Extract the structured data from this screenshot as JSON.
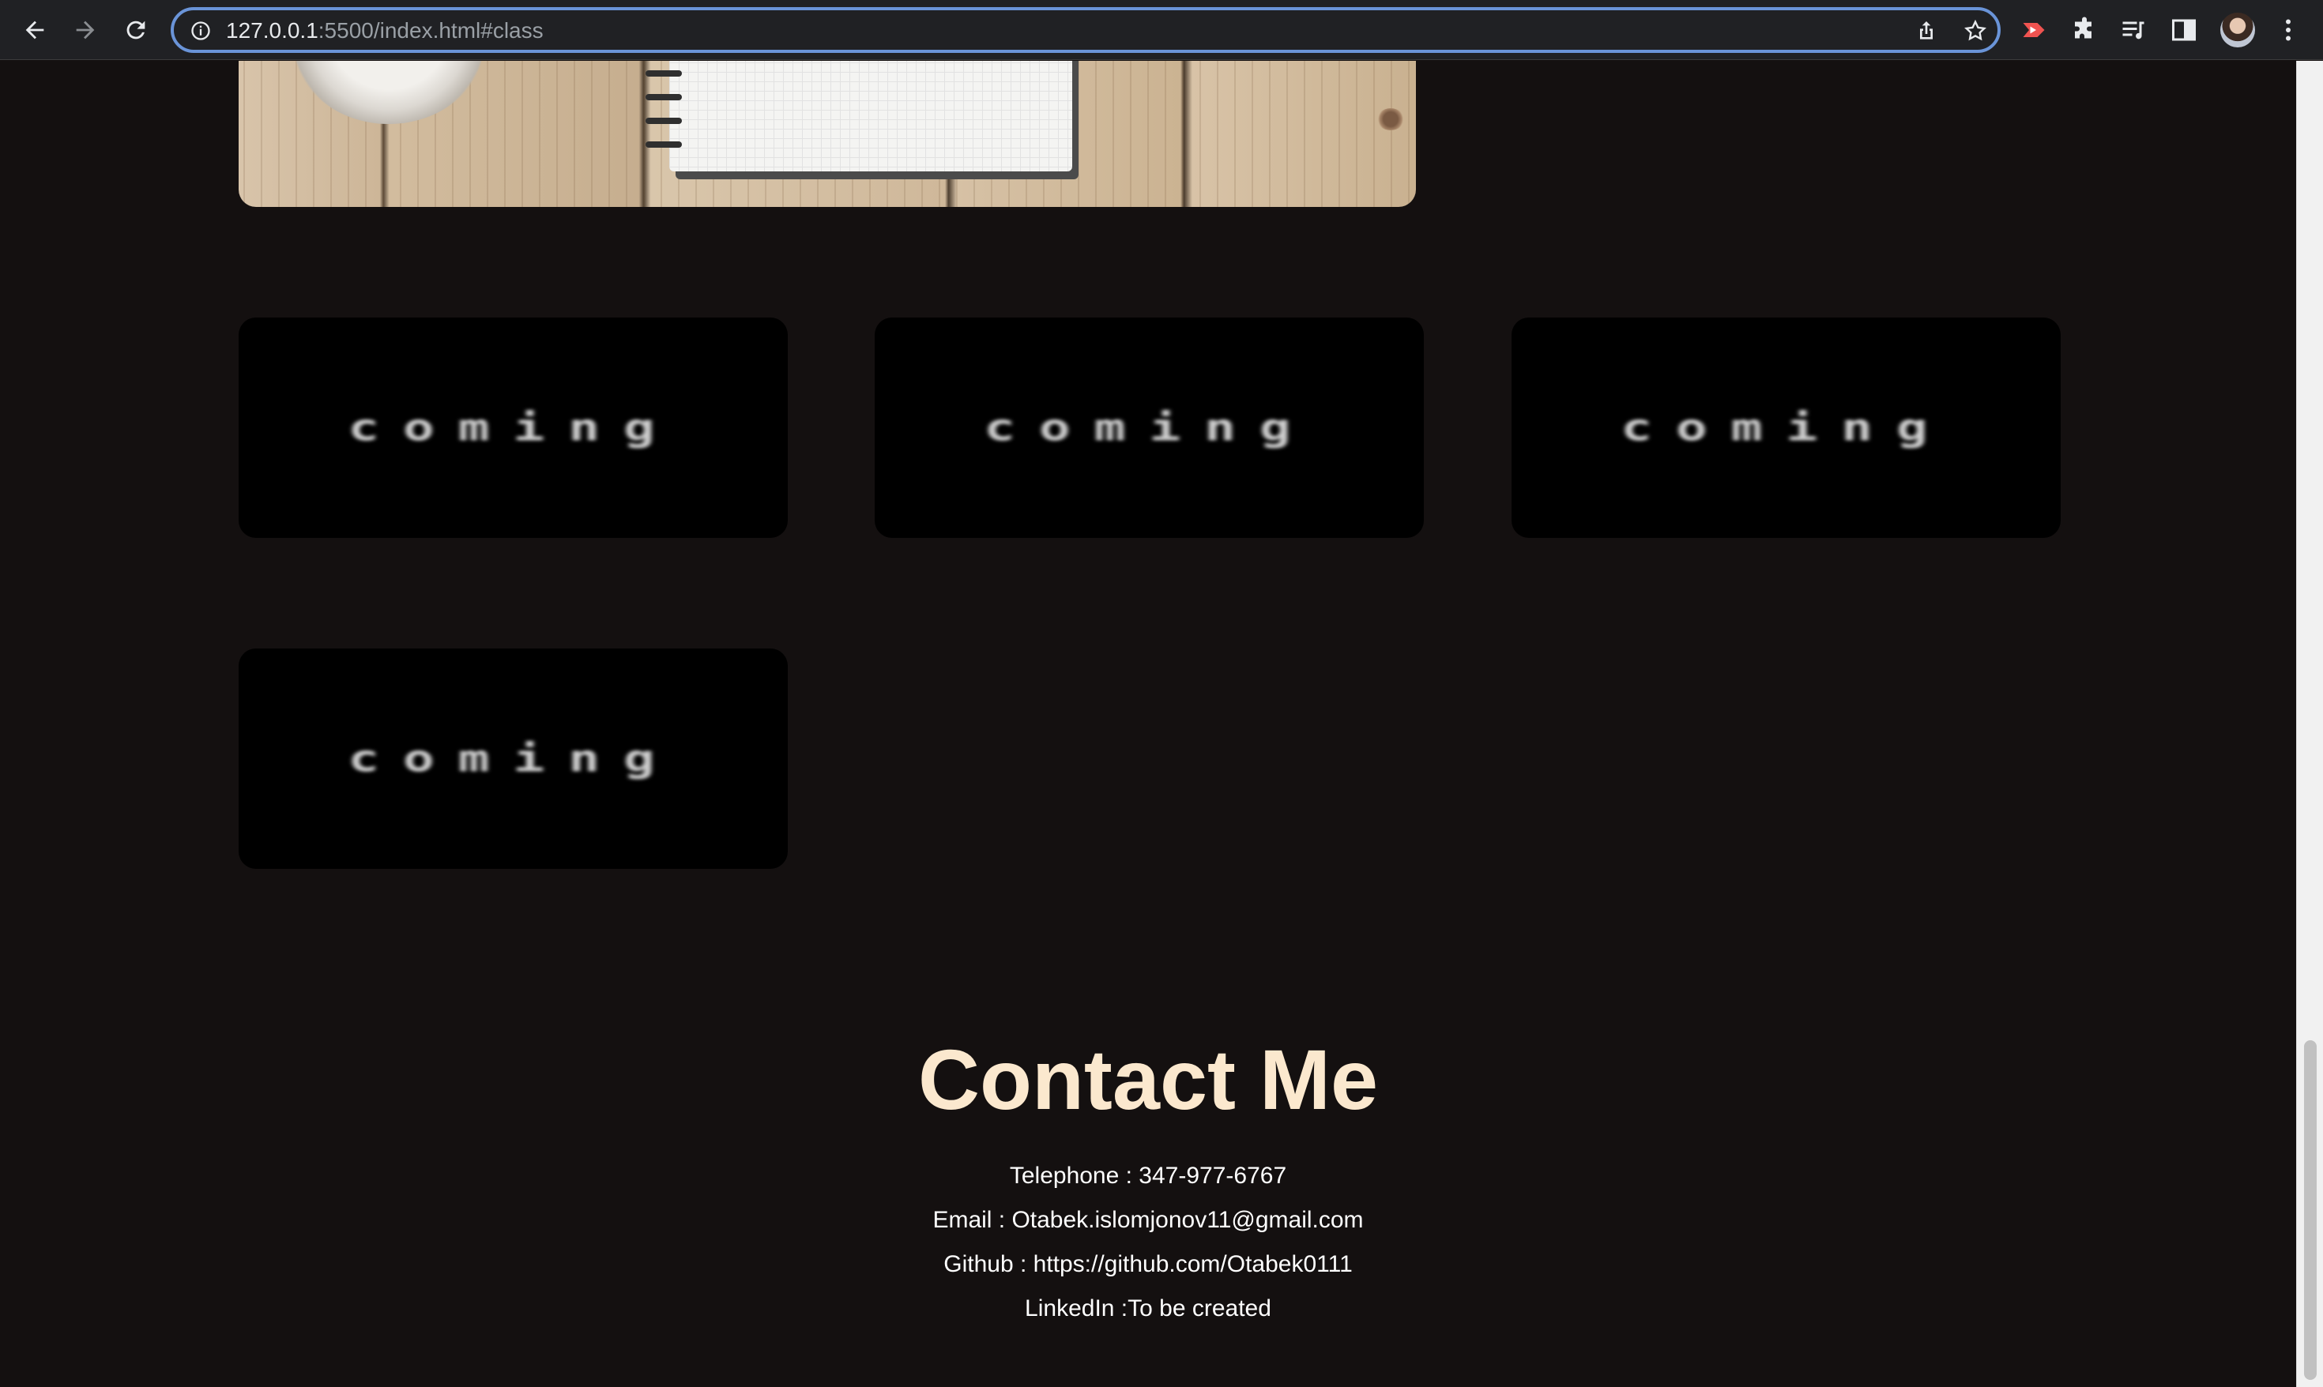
{
  "browser": {
    "url_host": "127.0.0.1",
    "url_rest": ":5500/index.html#class",
    "icons": [
      "back-arrow-icon",
      "forward-arrow-icon",
      "reload-icon",
      "site-info-icon",
      "share-icon",
      "bookmark-star-icon",
      "screencast-extension-icon",
      "extensions-puzzle-icon",
      "reading-list-icon",
      "side-panel-icon",
      "profile-avatar-icon",
      "kebab-menu-icon"
    ]
  },
  "projects": {
    "cards": [
      {
        "label": "coming"
      },
      {
        "label": "coming"
      },
      {
        "label": "coming"
      },
      {
        "label": "coming"
      }
    ]
  },
  "contact": {
    "title": "Contact Me",
    "lines": [
      "Telephone : 347-977-6767",
      "Email : Otabek.islomjonov11@gmail.com",
      "Github : https://github.com/Otabek0111",
      "LinkedIn :To be created"
    ]
  },
  "colors": {
    "page_bg": "#141010",
    "card_bg": "#000000",
    "title_color": "#fbe8ce",
    "text_color": "#ffffff",
    "omnibox_focus": "#6a94d8"
  }
}
